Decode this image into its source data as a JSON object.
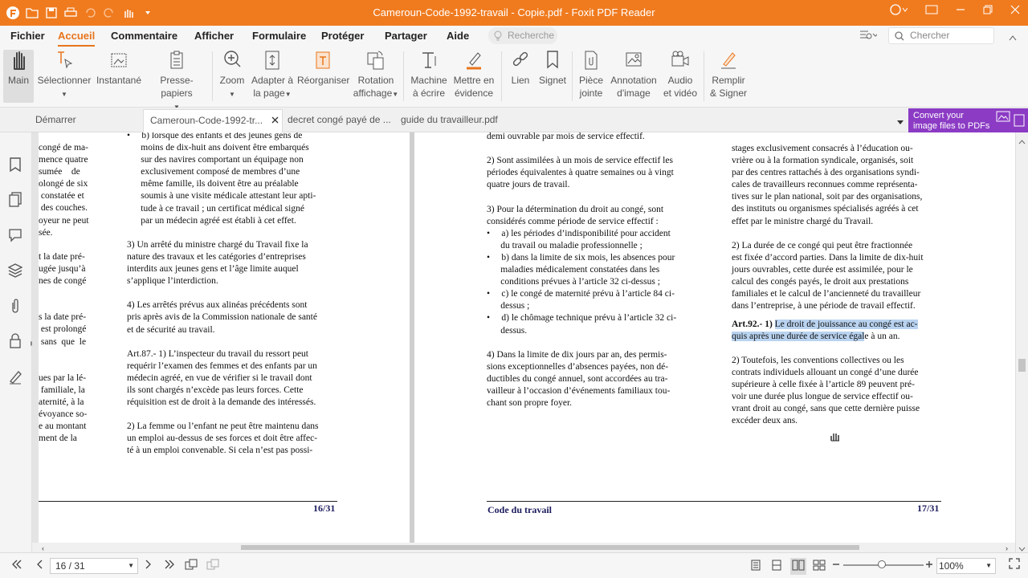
{
  "window": {
    "title": "Cameroun-Code-1992-travail - Copie.pdf - Foxit PDF Reader"
  },
  "menu": {
    "items": [
      "Fichier",
      "Accueil",
      "Commentaire",
      "Afficher",
      "Formulaire",
      "Protéger",
      "Partager",
      "Aide"
    ],
    "search_placeholder": "Recherche",
    "find_placeholder": "Chercher"
  },
  "toolbar": {
    "main": "Main",
    "select": "Sélectionner",
    "snapshot": "Instantané",
    "clipboard": "Presse-papiers",
    "zoom": "Zoom",
    "fit1": "Adapter à",
    "fit2": "la page",
    "reorganize": "Réorganiser",
    "rotate1": "Rotation",
    "rotate2": "affichage",
    "typewriter1": "Machine",
    "typewriter2": "à écrire",
    "highlight1": "Mettre en",
    "highlight2": "évidence",
    "link": "Lien",
    "bookmark": "Signet",
    "attach1": "Pièce",
    "attach2": "jointe",
    "imgannot1": "Annotation",
    "imgannot2": "d'image",
    "audio1": "Audio",
    "audio2": "et vidéo",
    "sign1": "Remplir",
    "sign2": "& Signer"
  },
  "tabs": {
    "start": "Démarrer",
    "t1": "Cameroun-Code-1992-tr...",
    "t2": "decret congé payé de ...",
    "t3": "guide du travailleur.pdf"
  },
  "promo": {
    "line1": "Convert your",
    "line2": "image files to PDFs"
  },
  "pages": {
    "left_cut": "congé de ma-\nmence quatre\nsumée    de\nolongé de six\n constatée et\n des couches.\noyeur ne peut\nsée.\n\nt la date pré-\nugée jusqu’à\nnes de congé\n\n\ns la date pré-\n est prolongé\n sans  que  le\n\n\nues par la lé-\n familiale, la\naternité, à la\névoyance so-\ne au montant\nment de la",
    "left_main": "•     b) lorsque des enfants et des jeunes gens de\n      moins de dix-huit ans doivent être embarqués\n      sur des navires comportant un équipage non\n      exclusivement composé de membres d’une\n      même famille, ils doivent être au préalable\n      soumis à une visite médicale attestant leur apti-\n      tude à ce travail ; un certificat médical signé\n      par un médecin agréé est établi à cet effet.\n\n3) Un arrêté du ministre chargé du Travail fixe la\nnature des travaux et les catégories d’entreprises\ninterdits aux jeunes gens et l’âge limite auquel\ns’applique l’interdiction.\n\n4) Les arrêtés prévus aux alinéas précédents sont\npris après avis de la Commission nationale de santé\net de sécurité au travail.\n\nArt.87.- 1) L’inspecteur du travail du ressort peut\nrequérir l’examen des femmes et des enfants par un\nmédecin agréé, en vue de vérifier si le travail dont\nils sont chargés n’excède pas leurs forces. Cette\nréquisition est de droit à la demande des intéressés.\n\n2) La femme ou l’enfant ne peut être maintenu dans\nun emploi au-dessus de ses forces et doit être affec-\nté à un emploi convenable. Si cela n’est pas possi-",
    "left_page_no": "16/31",
    "right_col1": "demi ouvrable par mois de service effectif.\n\n2) Sont assimilées à un mois de service effectif les\npériodes équivalentes à quatre semaines ou à vingt\nquatre jours de travail.\n\n3) Pour la détermination du droit au congé, sont\nconsidérés comme période de service effectif :\n•     a) les périodes d’indisponibilité pour accident\n      du travail ou maladie professionnelle ;\n•     b) dans la limite de six mois, les absences pour\n      maladies médicalement constatées dans les\n      conditions prévues à l’article 32 ci-dessus ;\n•     c) le congé de maternité prévu à l’article 84 ci-\n      dessus ;\n•     d) le chômage technique prévu à l’article 32 ci-\n      dessus.\n\n4) Dans la limite de dix jours par an, des permis-\nsions exceptionnelles d’absences payées, non dé-\nductibles du congé annuel, sont accordées au tra-\nvailleur à l’occasion d’événements familiaux tou-\nchant son propre foyer.",
    "right_col2a": "stages exclusivement consacrés à l’éducation ou-\nvrière ou à la formation syndicale, organisés, soit\npar des centres rattachés à des organisations syndi-\ncales de travailleurs reconnues comme représenta-\ntives sur le plan national, soit par des organisations,\ndes instituts ou organismes spécialisés agréés à cet\neffet par le ministre chargé du Travail.\n\n2) La durée de ce congé qui peut être fractionnée\nest fixée d’accord parties. Dans la limite de dix-huit\njours ouvrables, cette durée est assimilée, pour le\ncalcul des congés payés, le droit aux prestations\nfamiliales et le calcul de l’ancienneté du travailleur\ndans l’entreprise, à une période de travail effectif.",
    "art92_head": "Art.92.- 1) ",
    "art92_hl1": "Le droit de jouissance au congé est ac-",
    "art92_hl2": "quis après une durée de service égal",
    "art92_tail": "e à un an.",
    "right_col2b": "2) Toutefois, les conventions collectives ou les\ncontrats individuels allouant un congé d’une durée\nsupérieure à celle fixée à l’article 89 peuvent pré-\nvoir une durée plus longue de service effectif ou-\nvrant droit au congé, sans que cette dernière puisse\nexcéder deux ans.",
    "right_footer": "Code du travail",
    "right_page_no": "17/31"
  },
  "status": {
    "page": "16 / 31",
    "zoom": "100%"
  }
}
